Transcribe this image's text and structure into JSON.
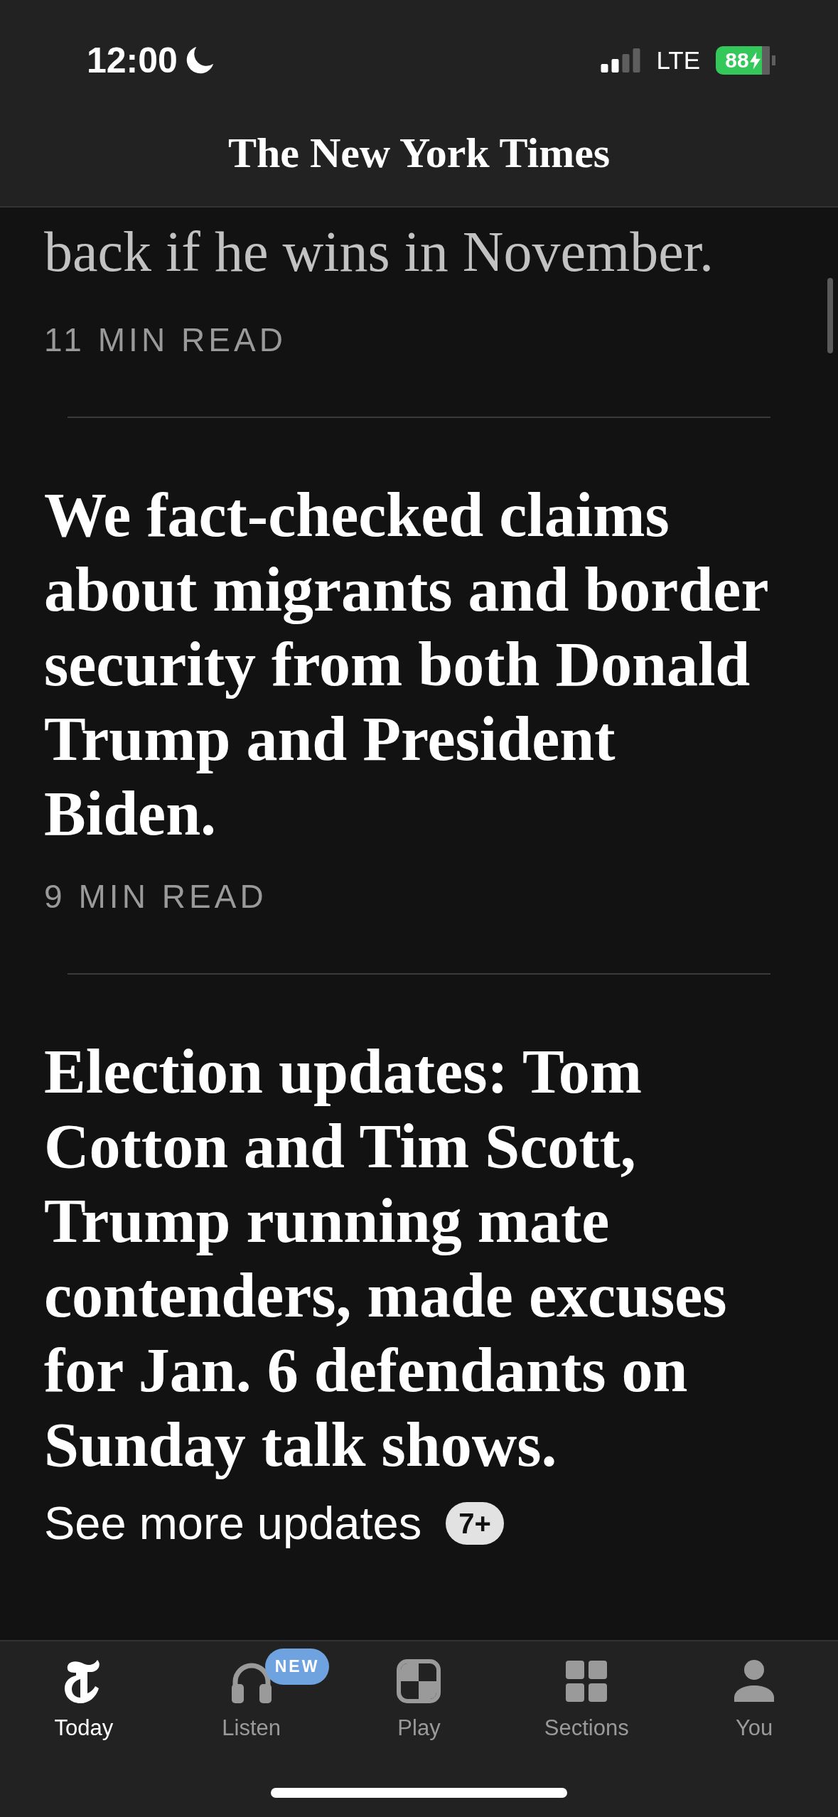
{
  "status_bar": {
    "time": "12:00",
    "network": "LTE",
    "battery": "88"
  },
  "header": {
    "title": "The New York Times"
  },
  "feed": [
    {
      "kind": "summary",
      "text": "back if he wins in November.",
      "meta": "11 MIN READ"
    },
    {
      "kind": "headline",
      "text": "We fact-checked claims about migrants and border security from both Donald Trump and President Biden.",
      "meta": "9 MIN READ"
    },
    {
      "kind": "headline",
      "text": "Election updates: Tom Cotton and Tim Scott, Trump running mate contenders, made excuses for Jan. 6 defendants on Sunday talk shows.",
      "link": "See more updates",
      "count": "7+"
    }
  ],
  "tab_bar": [
    {
      "label": "Today",
      "selected": true
    },
    {
      "label": "Listen",
      "selected": false,
      "badge": "NEW"
    },
    {
      "label": "Play",
      "selected": false
    },
    {
      "label": "Sections",
      "selected": false
    },
    {
      "label": "You",
      "selected": false
    }
  ]
}
